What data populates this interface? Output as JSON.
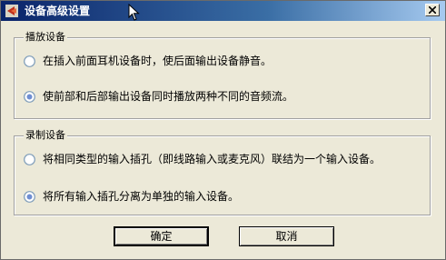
{
  "window": {
    "title": "设备高级设置",
    "accent_color": "#0a246a",
    "face_color": "#ece9d8"
  },
  "playback_group": {
    "label": "播放设备",
    "options": [
      {
        "label": "在插入前面耳机设备时，使后面输出设备静音。",
        "selected": false
      },
      {
        "label": "使前部和后部输出设备同时播放两种不同的音频流。",
        "selected": true
      }
    ]
  },
  "recording_group": {
    "label": "录制设备",
    "options": [
      {
        "label": "将相同类型的输入插孔（即线路输入或麦克风）联结为一个输入设备。",
        "selected": false
      },
      {
        "label": "将所有输入插孔分离为单独的输入设备。",
        "selected": true
      }
    ]
  },
  "buttons": {
    "ok_label": "确定",
    "cancel_label": "取消"
  },
  "icons": {
    "title": "realtek-crab-icon",
    "close": "close-icon",
    "pointer": "mouse-pointer-icon"
  }
}
